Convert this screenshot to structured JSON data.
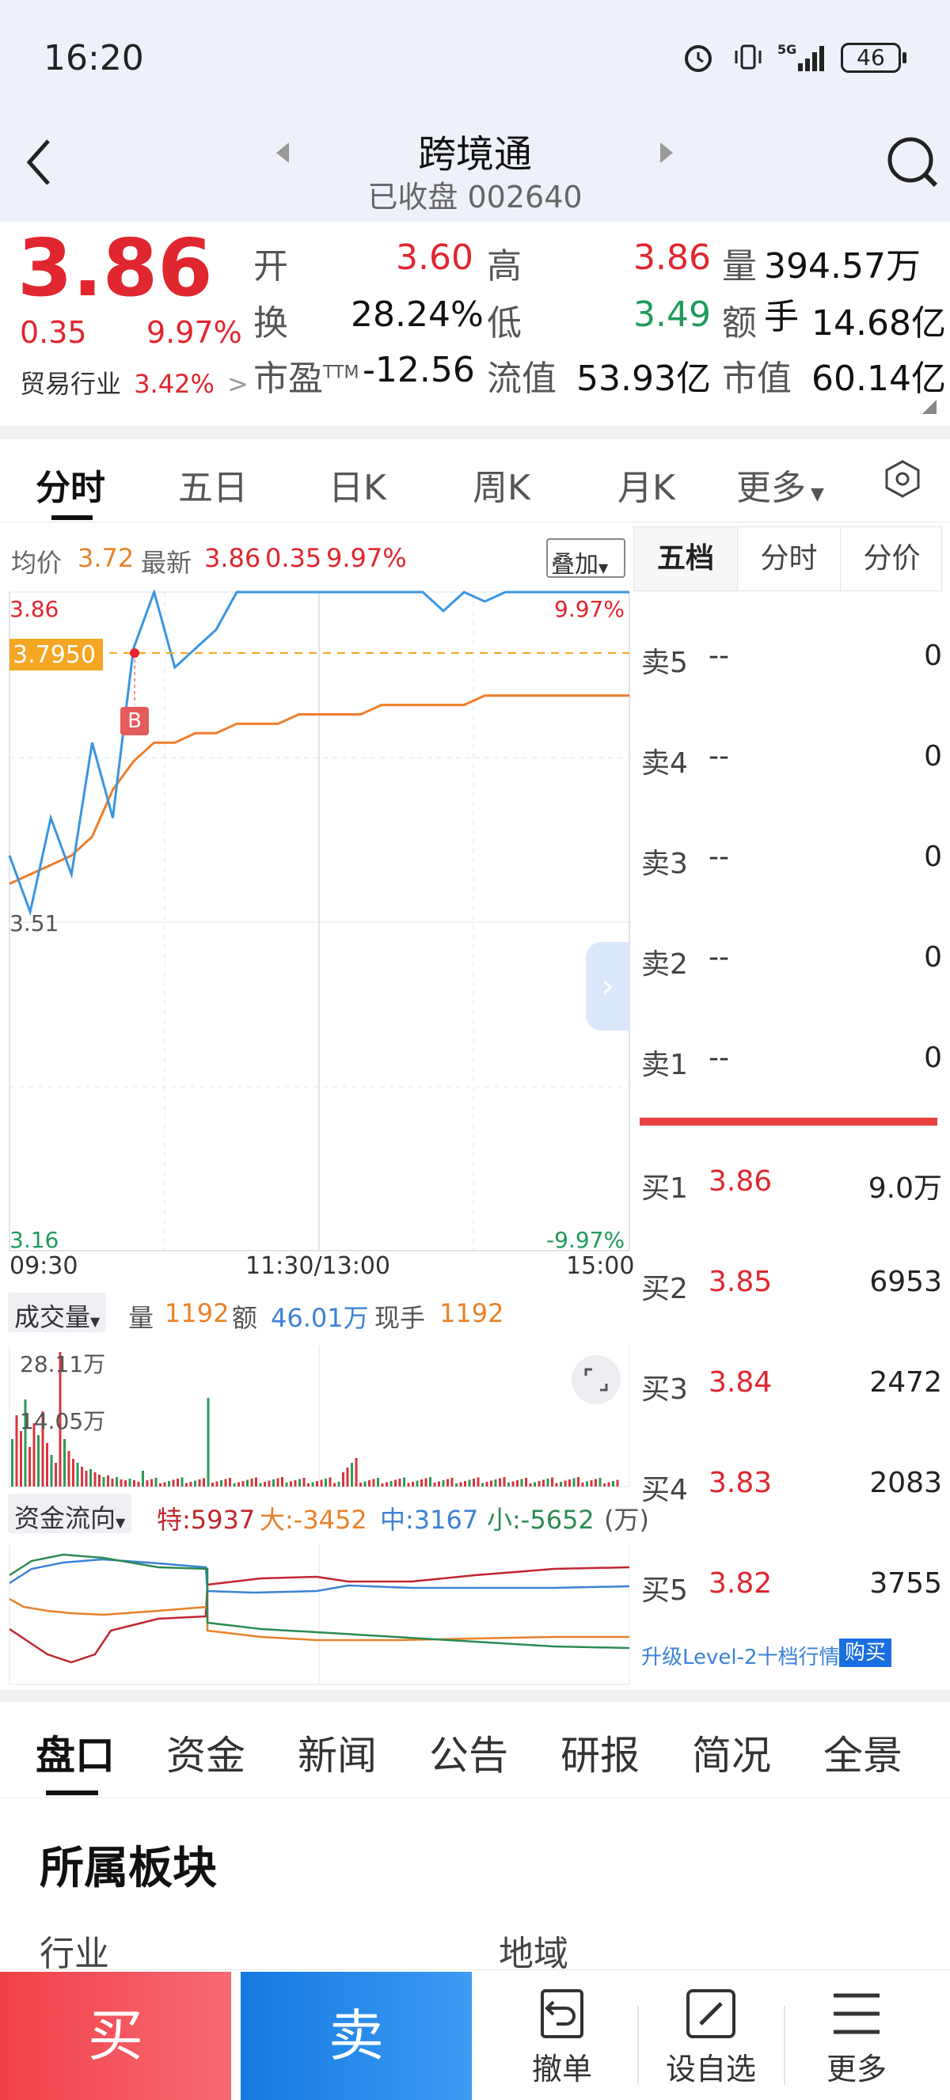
{
  "status": {
    "time": "16:20",
    "battery": "46"
  },
  "header": {
    "title": "跨境通",
    "subtitle": "已收盘 002640"
  },
  "quote": {
    "price": "3.86",
    "change": "0.35",
    "change_pct": "9.97%",
    "industry": "贸易行业",
    "industry_pct": "3.42%",
    "labels": {
      "open": "开",
      "high": "高",
      "vol": "量",
      "turnover": "换",
      "low": "低",
      "amount": "额",
      "pe": "市盈",
      "pe_sup": "TTM",
      "float_cap": "流值",
      "mkt_cap": "市值"
    },
    "open": "3.60",
    "high": "3.86",
    "vol": "394.57万手",
    "turnover": "28.24%",
    "low": "3.49",
    "amount": "14.68亿",
    "pe": "-12.56",
    "float_cap": "53.93亿",
    "mkt_cap": "60.14亿"
  },
  "chart_tabs": [
    "分时",
    "五日",
    "日K",
    "周K",
    "月K",
    "更多"
  ],
  "intraday": {
    "avg_label": "均价",
    "avg": "3.72",
    "last_label": "最新",
    "last": "3.86",
    "chg": "0.35",
    "pct": "9.97%",
    "overlay_btn": "叠加",
    "y_high": "3.86",
    "y_mid": "3.51",
    "y_low": "3.16",
    "pct_high": "9.97%",
    "pct_low": "-9.97%",
    "cursor_price": "3.7950",
    "marker": "B",
    "x_start": "09:30",
    "x_mid": "11:30/13:00",
    "x_end": "15:00"
  },
  "chart_data": {
    "type": "line",
    "title": "",
    "ylim": [
      3.16,
      3.86
    ],
    "x_ticks": [
      "09:30",
      "11:30/13:00",
      "15:00"
    ],
    "series": [
      {
        "name": "最新",
        "values": [
          3.58,
          3.52,
          3.62,
          3.56,
          3.7,
          3.62,
          3.8,
          3.86,
          3.78,
          3.8,
          3.82,
          3.86,
          3.86,
          3.86,
          3.86,
          3.86,
          3.86,
          3.86,
          3.86,
          3.86,
          3.86,
          3.84,
          3.86,
          3.85,
          3.86,
          3.86,
          3.86,
          3.86,
          3.86,
          3.86,
          3.86
        ]
      },
      {
        "name": "均价",
        "values": [
          3.55,
          3.56,
          3.57,
          3.58,
          3.6,
          3.65,
          3.68,
          3.7,
          3.7,
          3.71,
          3.71,
          3.72,
          3.72,
          3.72,
          3.73,
          3.73,
          3.73,
          3.73,
          3.74,
          3.74,
          3.74,
          3.74,
          3.74,
          3.75,
          3.75,
          3.75,
          3.75,
          3.75,
          3.75,
          3.75,
          3.75
        ]
      }
    ]
  },
  "volume": {
    "label": "成交量",
    "vol_label": "量",
    "vol": "1192",
    "amt_label": "额",
    "amt": "46.01万",
    "hand_label": "现手",
    "hand": "1192",
    "y_top": "28.11万",
    "y_mid": "14.05万"
  },
  "moneyflow": {
    "label": "资金流向",
    "te_label": "特",
    "te": "5937",
    "da_label": "大",
    "da": "-3452",
    "zhong_label": "中",
    "zhong": "3167",
    "xiao_label": "小",
    "xiao": "-5652",
    "unit": "(万)"
  },
  "orderbook": {
    "tabs": [
      "五档",
      "分时",
      "分价"
    ],
    "asks": [
      {
        "label": "卖5",
        "price": "--",
        "vol": "0"
      },
      {
        "label": "卖4",
        "price": "--",
        "vol": "0"
      },
      {
        "label": "卖3",
        "price": "--",
        "vol": "0"
      },
      {
        "label": "卖2",
        "price": "--",
        "vol": "0"
      },
      {
        "label": "卖1",
        "price": "--",
        "vol": "0"
      }
    ],
    "bids": [
      {
        "label": "买1",
        "price": "3.86",
        "vol": "9.0万"
      },
      {
        "label": "买2",
        "price": "3.85",
        "vol": "6953"
      },
      {
        "label": "买3",
        "price": "3.84",
        "vol": "2472"
      },
      {
        "label": "买4",
        "price": "3.83",
        "vol": "2083"
      },
      {
        "label": "买5",
        "price": "3.82",
        "vol": "3755"
      }
    ],
    "upgrade": "升级Level-2十档行情",
    "buy_btn": "购买"
  },
  "info_tabs": [
    "盘口",
    "资金",
    "新闻",
    "公告",
    "研报",
    "简况",
    "全景"
  ],
  "section": {
    "title": "所属板块",
    "col1": "行业",
    "col2": "地域"
  },
  "bottom": {
    "buy": "买",
    "sell": "卖",
    "cancel": "撤单",
    "watch": "设自选",
    "more": "更多"
  }
}
